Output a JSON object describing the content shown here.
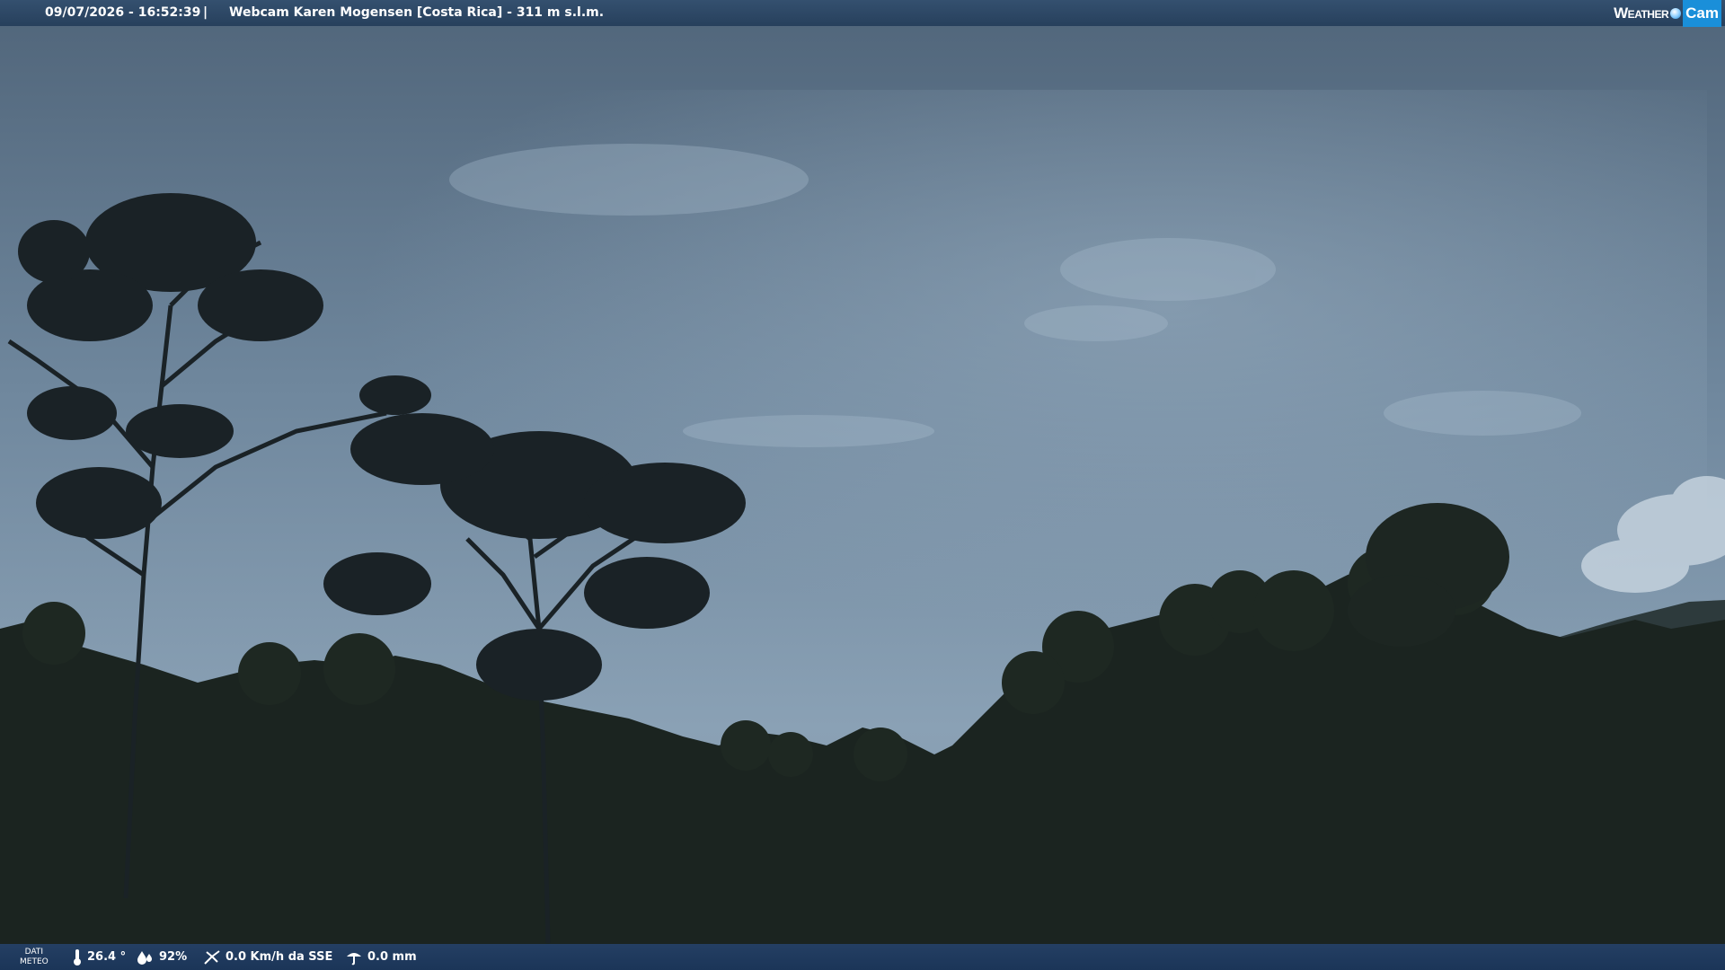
{
  "header": {
    "datetime": "09/07/2026 - 16:52:39",
    "separator": "|",
    "title": "Webcam Karen Mogensen [Costa Rica]  - 311 m s.l.m.",
    "logo_word": "Weather",
    "logo_cam": "Cam"
  },
  "footer": {
    "dati_line1": "DATI",
    "dati_line2": "METEO",
    "temperature": "26.4 °",
    "humidity": "92%",
    "wind": "0.0 Km/h da SSE",
    "rain": "0.0 mm"
  },
  "icons": {
    "temperature": "thermometer-icon",
    "humidity": "humidity-drop-icon",
    "wind": "wind-icon",
    "rain": "rain-gauge-icon"
  },
  "colors": {
    "sky_top": "#52677c",
    "sky_mid": "#7e97ad",
    "forest": "#1b2420",
    "bar_top": "#34506f",
    "bar_bottom": "#1b3558",
    "logo_accent": "#1a8fd9"
  }
}
